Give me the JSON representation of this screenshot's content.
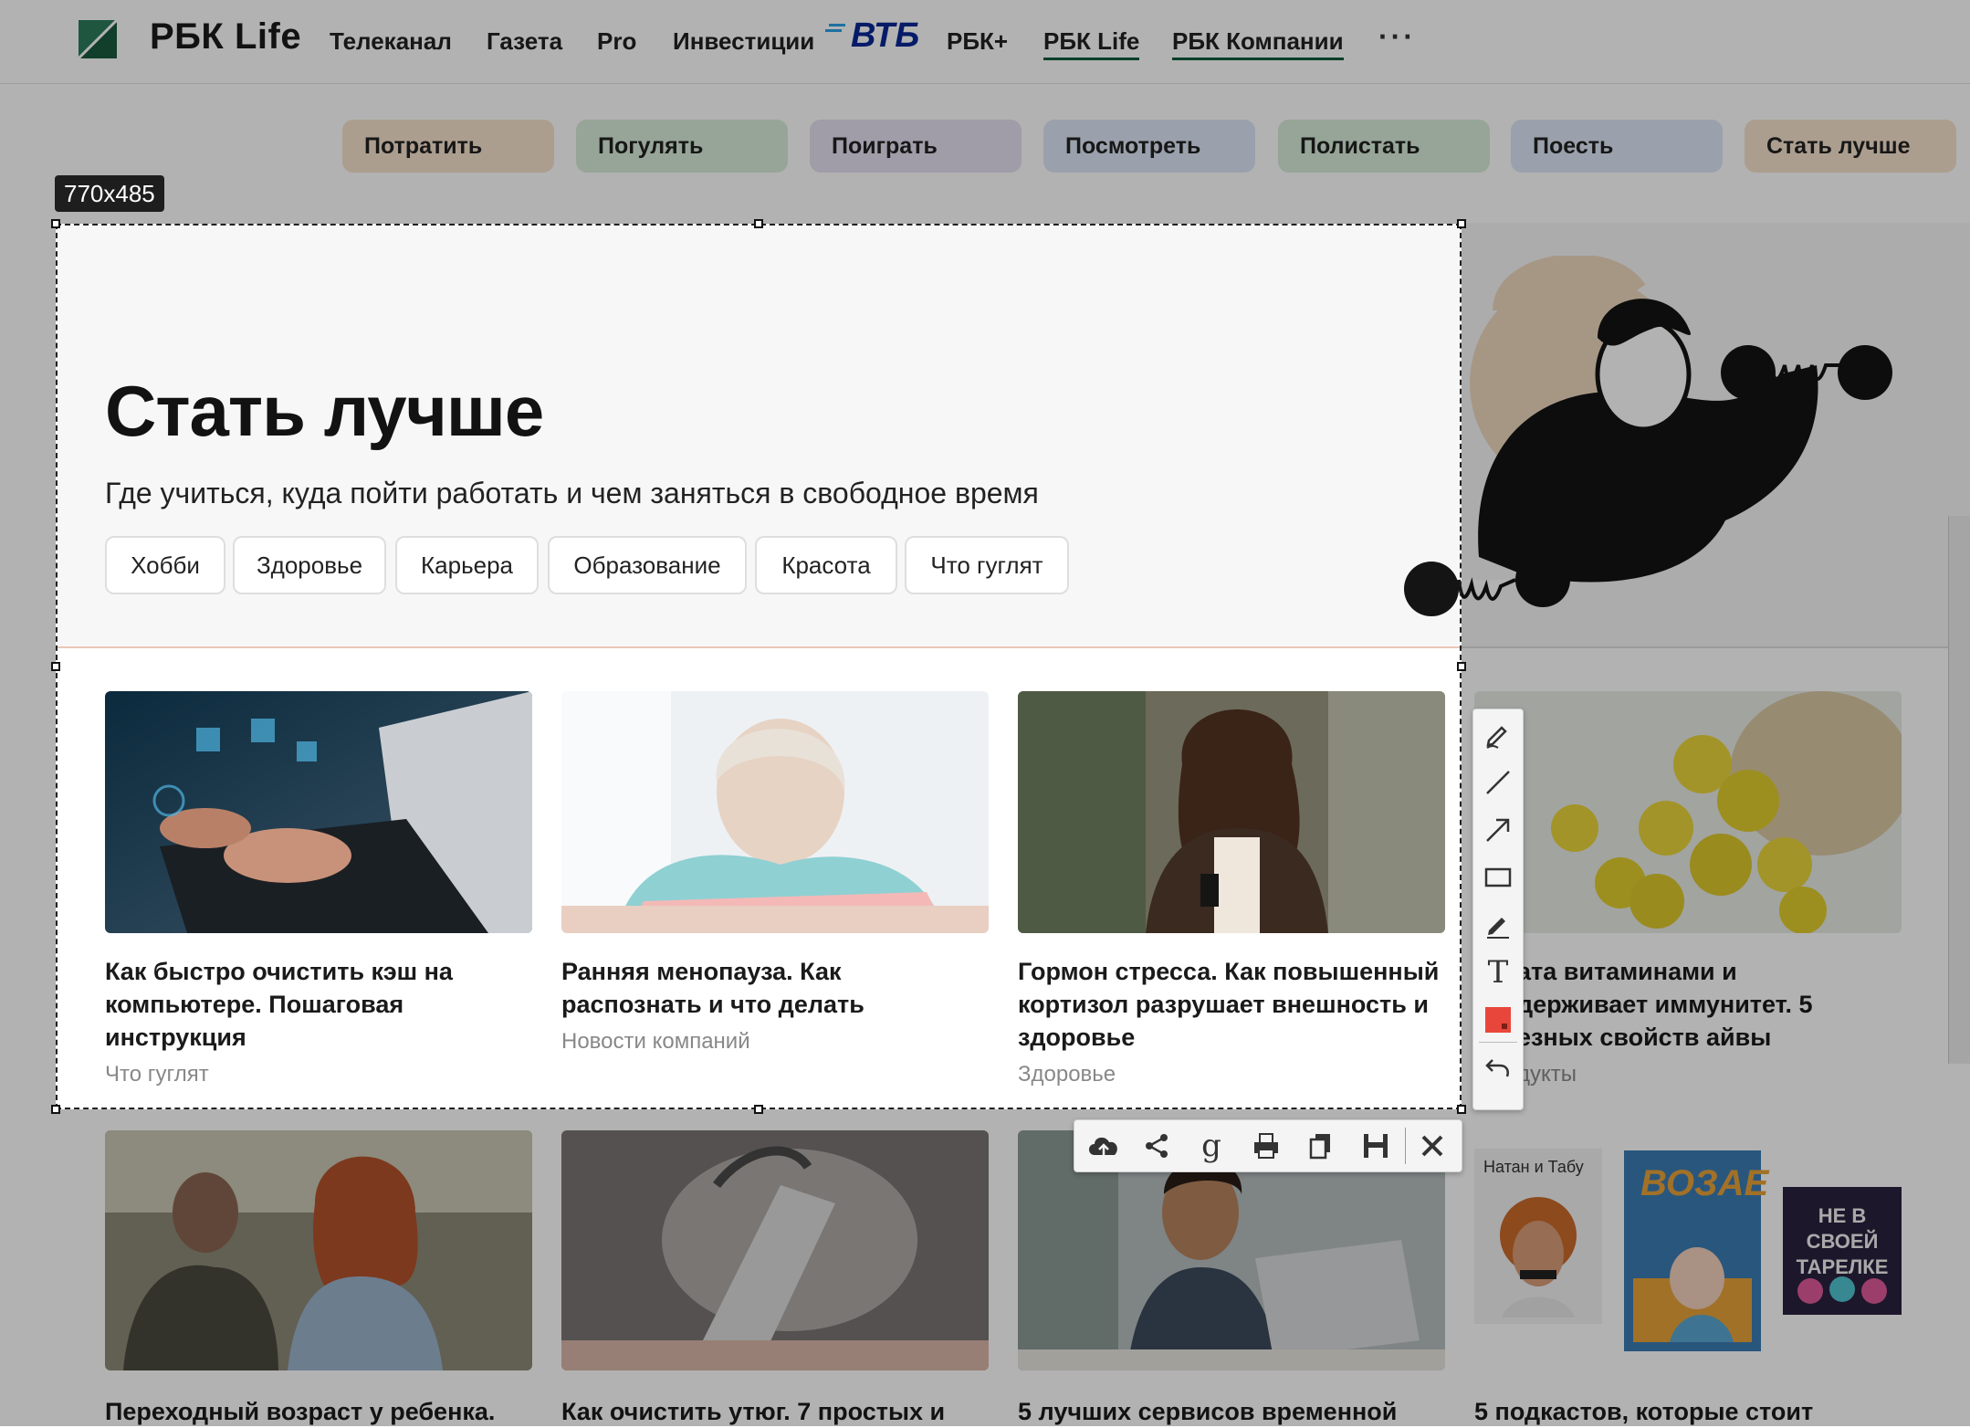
{
  "header": {
    "logo_text": "РБК Life",
    "nav": [
      "Телеканал",
      "Газета",
      "Pro",
      "Инвестиции",
      "РБК+",
      "РБК Life",
      "РБК Компании"
    ],
    "sponsor": "ВТБ",
    "more": "···"
  },
  "pills": [
    {
      "label": "Потратить",
      "color": "#f6e3cd"
    },
    {
      "label": "Погулять",
      "color": "#d7ecd9"
    },
    {
      "label": "Поиграть",
      "color": "#e6e1f3"
    },
    {
      "label": "Посмотреть",
      "color": "#dde7f6"
    },
    {
      "label": "Полистать",
      "color": "#d7ecd9"
    },
    {
      "label": "Поесть",
      "color": "#dde7f6"
    },
    {
      "label": "Стать лучше",
      "color": "#f6e3cd"
    }
  ],
  "hero": {
    "title": "Стать лучше",
    "subtitle": "Где учиться, куда пойти работать и чем заняться в свободное время",
    "tags": [
      "Хобби",
      "Здоровье",
      "Карьера",
      "Образование",
      "Красота",
      "Что гуглят"
    ]
  },
  "cards_row1": [
    {
      "title": "Как быстро очистить кэш на компьютере. Пошаговая инструкция",
      "category": "Что гуглят"
    },
    {
      "title": "Ранняя менопауза. Как распознать и что делать",
      "category": "Новости компаний"
    },
    {
      "title": "Гормон стресса. Как повышенный кортизол разрушает внешность и здоровье",
      "category": "Здоровье"
    },
    {
      "title": "ата витаминами и держивает иммунитет. 5 езных свойств айвы",
      "category": "дукты"
    }
  ],
  "cards_row2": [
    {
      "title": "Переходный возраст у ребенка."
    },
    {
      "title": "Как очистить утюг. 7 простых и"
    },
    {
      "title": "5 лучших сервисов временной"
    },
    {
      "title": "5 подкастов, которые стоит"
    }
  ],
  "podcast_covers": {
    "cover1": "Натан и Табу",
    "cover2": "ВОЗАЕ",
    "cover3": "НЕ В СВОЕЙ ТАРЕЛКЕ"
  },
  "screenshot_tool": {
    "size_label": "770x485",
    "vertical_tools": [
      "pencil-icon",
      "line-icon",
      "arrow-icon",
      "rectangle-icon",
      "marker-icon",
      "text-icon",
      "color-icon",
      "undo-icon"
    ],
    "horizontal_tools": [
      "upload-icon",
      "share-icon",
      "google-icon",
      "print-icon",
      "copy-icon",
      "save-icon",
      "close-icon"
    ],
    "text_tool_label": "T",
    "google_label": "g",
    "accent_color": "#e8463a"
  }
}
